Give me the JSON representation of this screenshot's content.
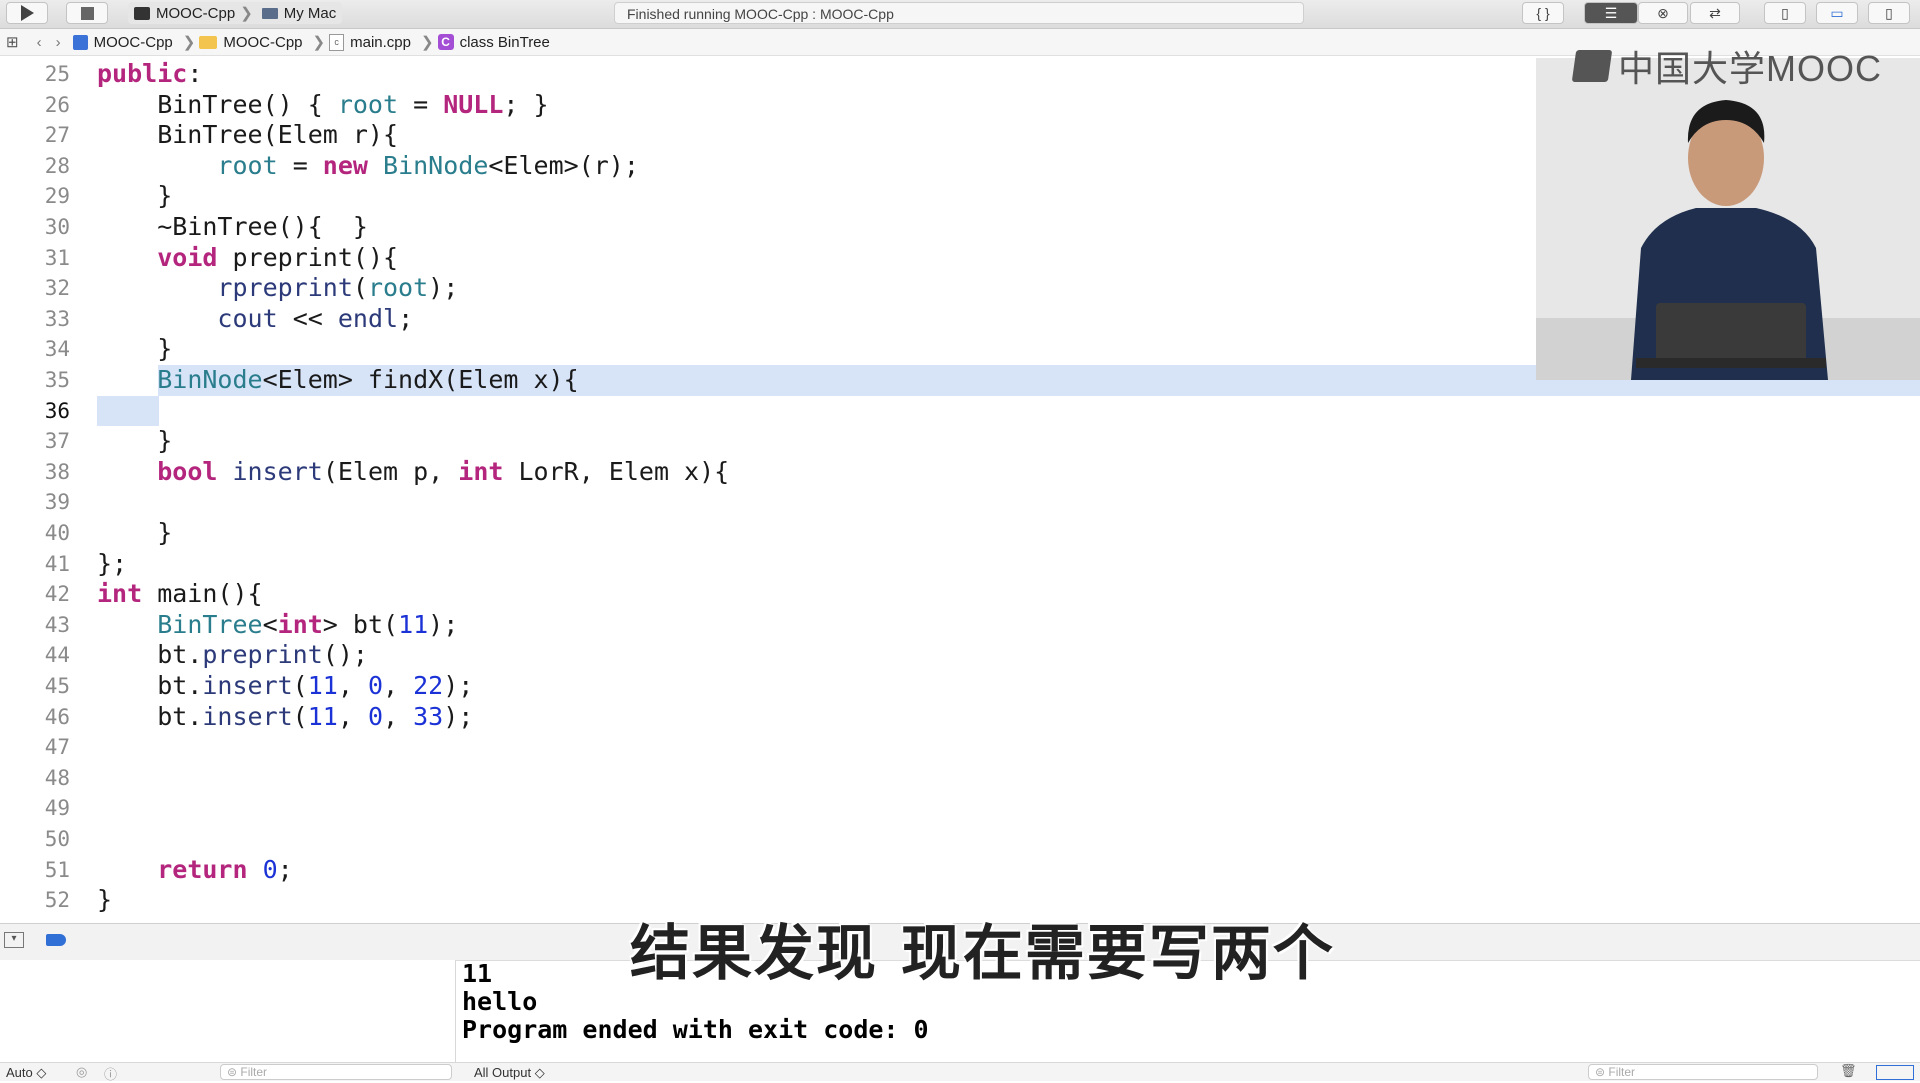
{
  "toolbar": {
    "run_icon": "play-icon",
    "stop_icon": "stop-icon",
    "scheme": "MOOC-Cpp",
    "destination": "My Mac",
    "status": "Finished running MOOC-Cpp : MOOC-Cpp",
    "right_icons": [
      "braces-icon",
      "standard-editor-icon",
      "assistant-editor-icon",
      "version-editor-icon",
      "navigator-toggle-icon",
      "debug-area-toggle-icon",
      "utilities-toggle-icon"
    ]
  },
  "jumpbar": {
    "items": [
      "MOOC-Cpp",
      "MOOC-Cpp",
      "main.cpp",
      "class BinTree"
    ]
  },
  "editor": {
    "current_line": 36,
    "lines": [
      {
        "n": "25",
        "c": "public:"
      },
      {
        "n": "26",
        "c": "    BinTree() { root = NULL; }"
      },
      {
        "n": "27",
        "c": "    BinTree(Elem r){"
      },
      {
        "n": "28",
        "c": "        root = new BinNode<Elem>(r);"
      },
      {
        "n": "29",
        "c": "    }"
      },
      {
        "n": "30",
        "c": "    ~BinTree(){  }"
      },
      {
        "n": "31",
        "c": "    void preprint(){"
      },
      {
        "n": "32",
        "c": "        rpreprint(root);"
      },
      {
        "n": "33",
        "c": "        cout << endl;"
      },
      {
        "n": "34",
        "c": "    }"
      },
      {
        "n": "35",
        "c": "    BinNode<Elem> findX(Elem x){"
      },
      {
        "n": "36",
        "c": ""
      },
      {
        "n": "37",
        "c": "    }"
      },
      {
        "n": "38",
        "c": "    bool insert(Elem p, int LorR, Elem x){"
      },
      {
        "n": "39",
        "c": ""
      },
      {
        "n": "40",
        "c": "    }"
      },
      {
        "n": "41",
        "c": "};"
      },
      {
        "n": "42",
        "c": "int main(){"
      },
      {
        "n": "43",
        "c": "    BinTree<int> bt(11);"
      },
      {
        "n": "44",
        "c": "    bt.preprint();"
      },
      {
        "n": "45",
        "c": "    bt.insert(11, 0, 22);"
      },
      {
        "n": "46",
        "c": "    bt.insert(11, 0, 33);"
      },
      {
        "n": "47",
        "c": ""
      },
      {
        "n": "48",
        "c": ""
      },
      {
        "n": "49",
        "c": ""
      },
      {
        "n": "50",
        "c": ""
      },
      {
        "n": "51",
        "c": "    return 0;"
      },
      {
        "n": "52",
        "c": "}"
      }
    ]
  },
  "video": {
    "logo_text": "中国大学MOOC"
  },
  "console": {
    "lines": [
      "11",
      "hello",
      "Program ended with exit code: 0"
    ]
  },
  "subtitle": "结果发现 现在需要写两个",
  "bottom": {
    "auto_label": "Auto ◇",
    "filter_placeholder": "Filter",
    "output_selector": "All Output ◇",
    "filter_right_placeholder": "Filter"
  },
  "colors": {
    "keyword": "#b4267d",
    "type": "#2a7d8c",
    "number": "#1b32d6",
    "current_line_highlight": "#d7e4f8"
  }
}
